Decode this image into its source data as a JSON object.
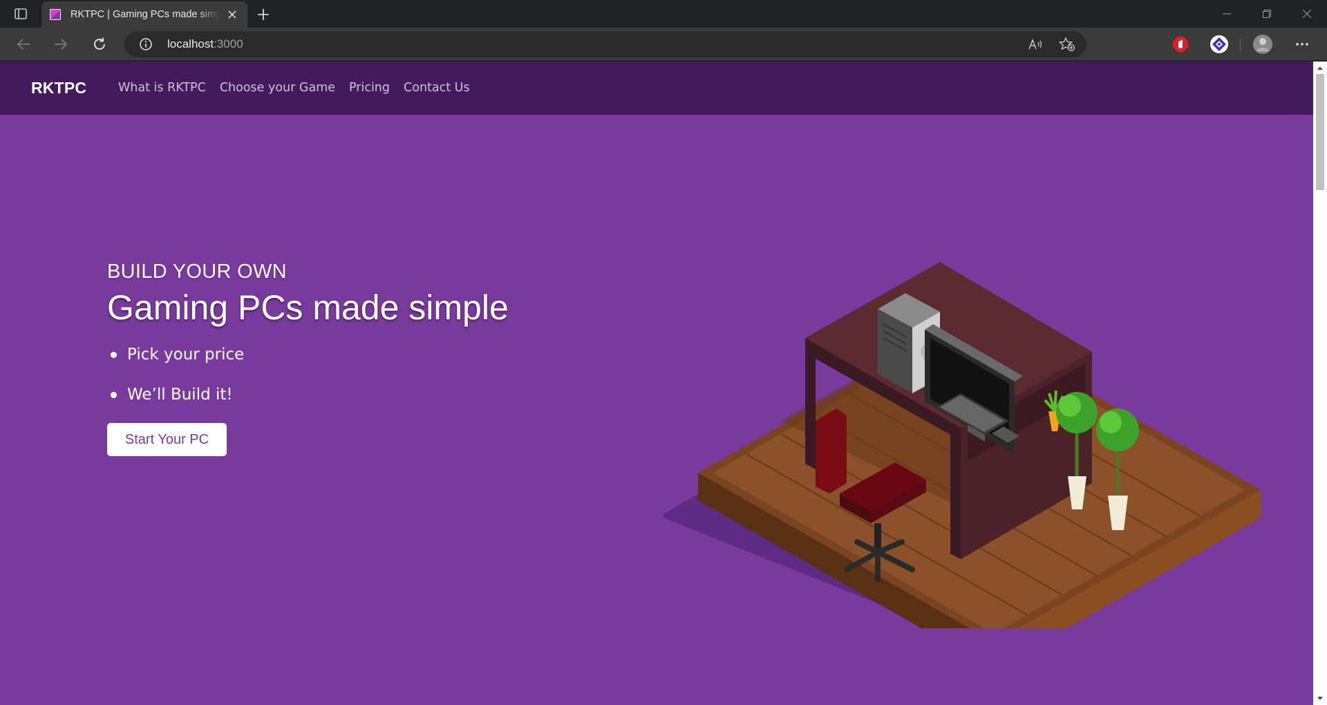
{
  "browser": {
    "tab_title": "RKTPC | Gaming PCs made simple",
    "url_host": "localhost",
    "url_port": ":3000"
  },
  "site": {
    "brand": "RKTPC",
    "nav": [
      "What is RKTPC",
      "Choose your Game",
      "Pricing",
      "Contact Us"
    ]
  },
  "hero": {
    "kicker": "BUILD YOUR OWN",
    "headline": "Gaming PCs made simple",
    "bullets": [
      "Pick your price",
      "We’ll Build it!"
    ],
    "cta": "Start Your PC"
  },
  "colors": {
    "page_bg": "#783a9c",
    "nav_bg": "#431b5c",
    "accent": "#783a9c"
  },
  "icons": [
    "tab-actions-icon",
    "close-icon",
    "plus-icon",
    "minimize-icon",
    "restore-icon",
    "back-icon",
    "forward-icon",
    "reload-icon",
    "info-icon",
    "read-aloud-icon",
    "favorites-icon",
    "adblock-extension-icon",
    "vpn-extension-icon",
    "profile-avatar",
    "more-icon"
  ]
}
